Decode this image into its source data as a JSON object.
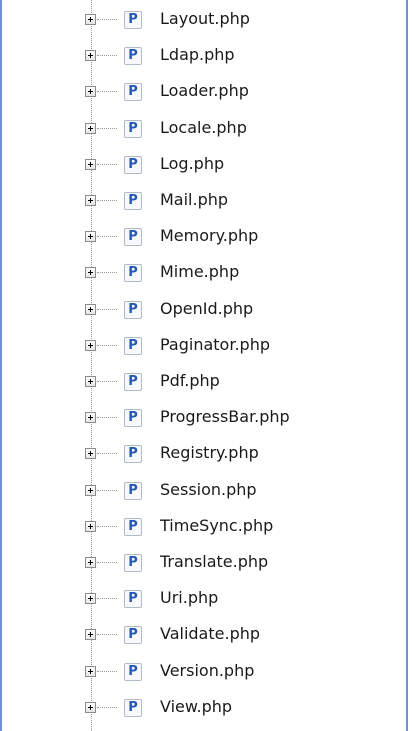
{
  "file_icon_glyph": "P",
  "files": [
    {
      "name": "Layout.php"
    },
    {
      "name": "Ldap.php"
    },
    {
      "name": "Loader.php"
    },
    {
      "name": "Locale.php"
    },
    {
      "name": "Log.php"
    },
    {
      "name": "Mail.php"
    },
    {
      "name": "Memory.php"
    },
    {
      "name": "Mime.php"
    },
    {
      "name": "OpenId.php"
    },
    {
      "name": "Paginator.php"
    },
    {
      "name": "Pdf.php"
    },
    {
      "name": "ProgressBar.php"
    },
    {
      "name": "Registry.php"
    },
    {
      "name": "Session.php"
    },
    {
      "name": "TimeSync.php"
    },
    {
      "name": "Translate.php"
    },
    {
      "name": "Uri.php"
    },
    {
      "name": "Validate.php"
    },
    {
      "name": "Version.php"
    },
    {
      "name": "View.php"
    }
  ],
  "icons": {
    "expander": "plus-box-icon",
    "file": "php-file-icon"
  }
}
